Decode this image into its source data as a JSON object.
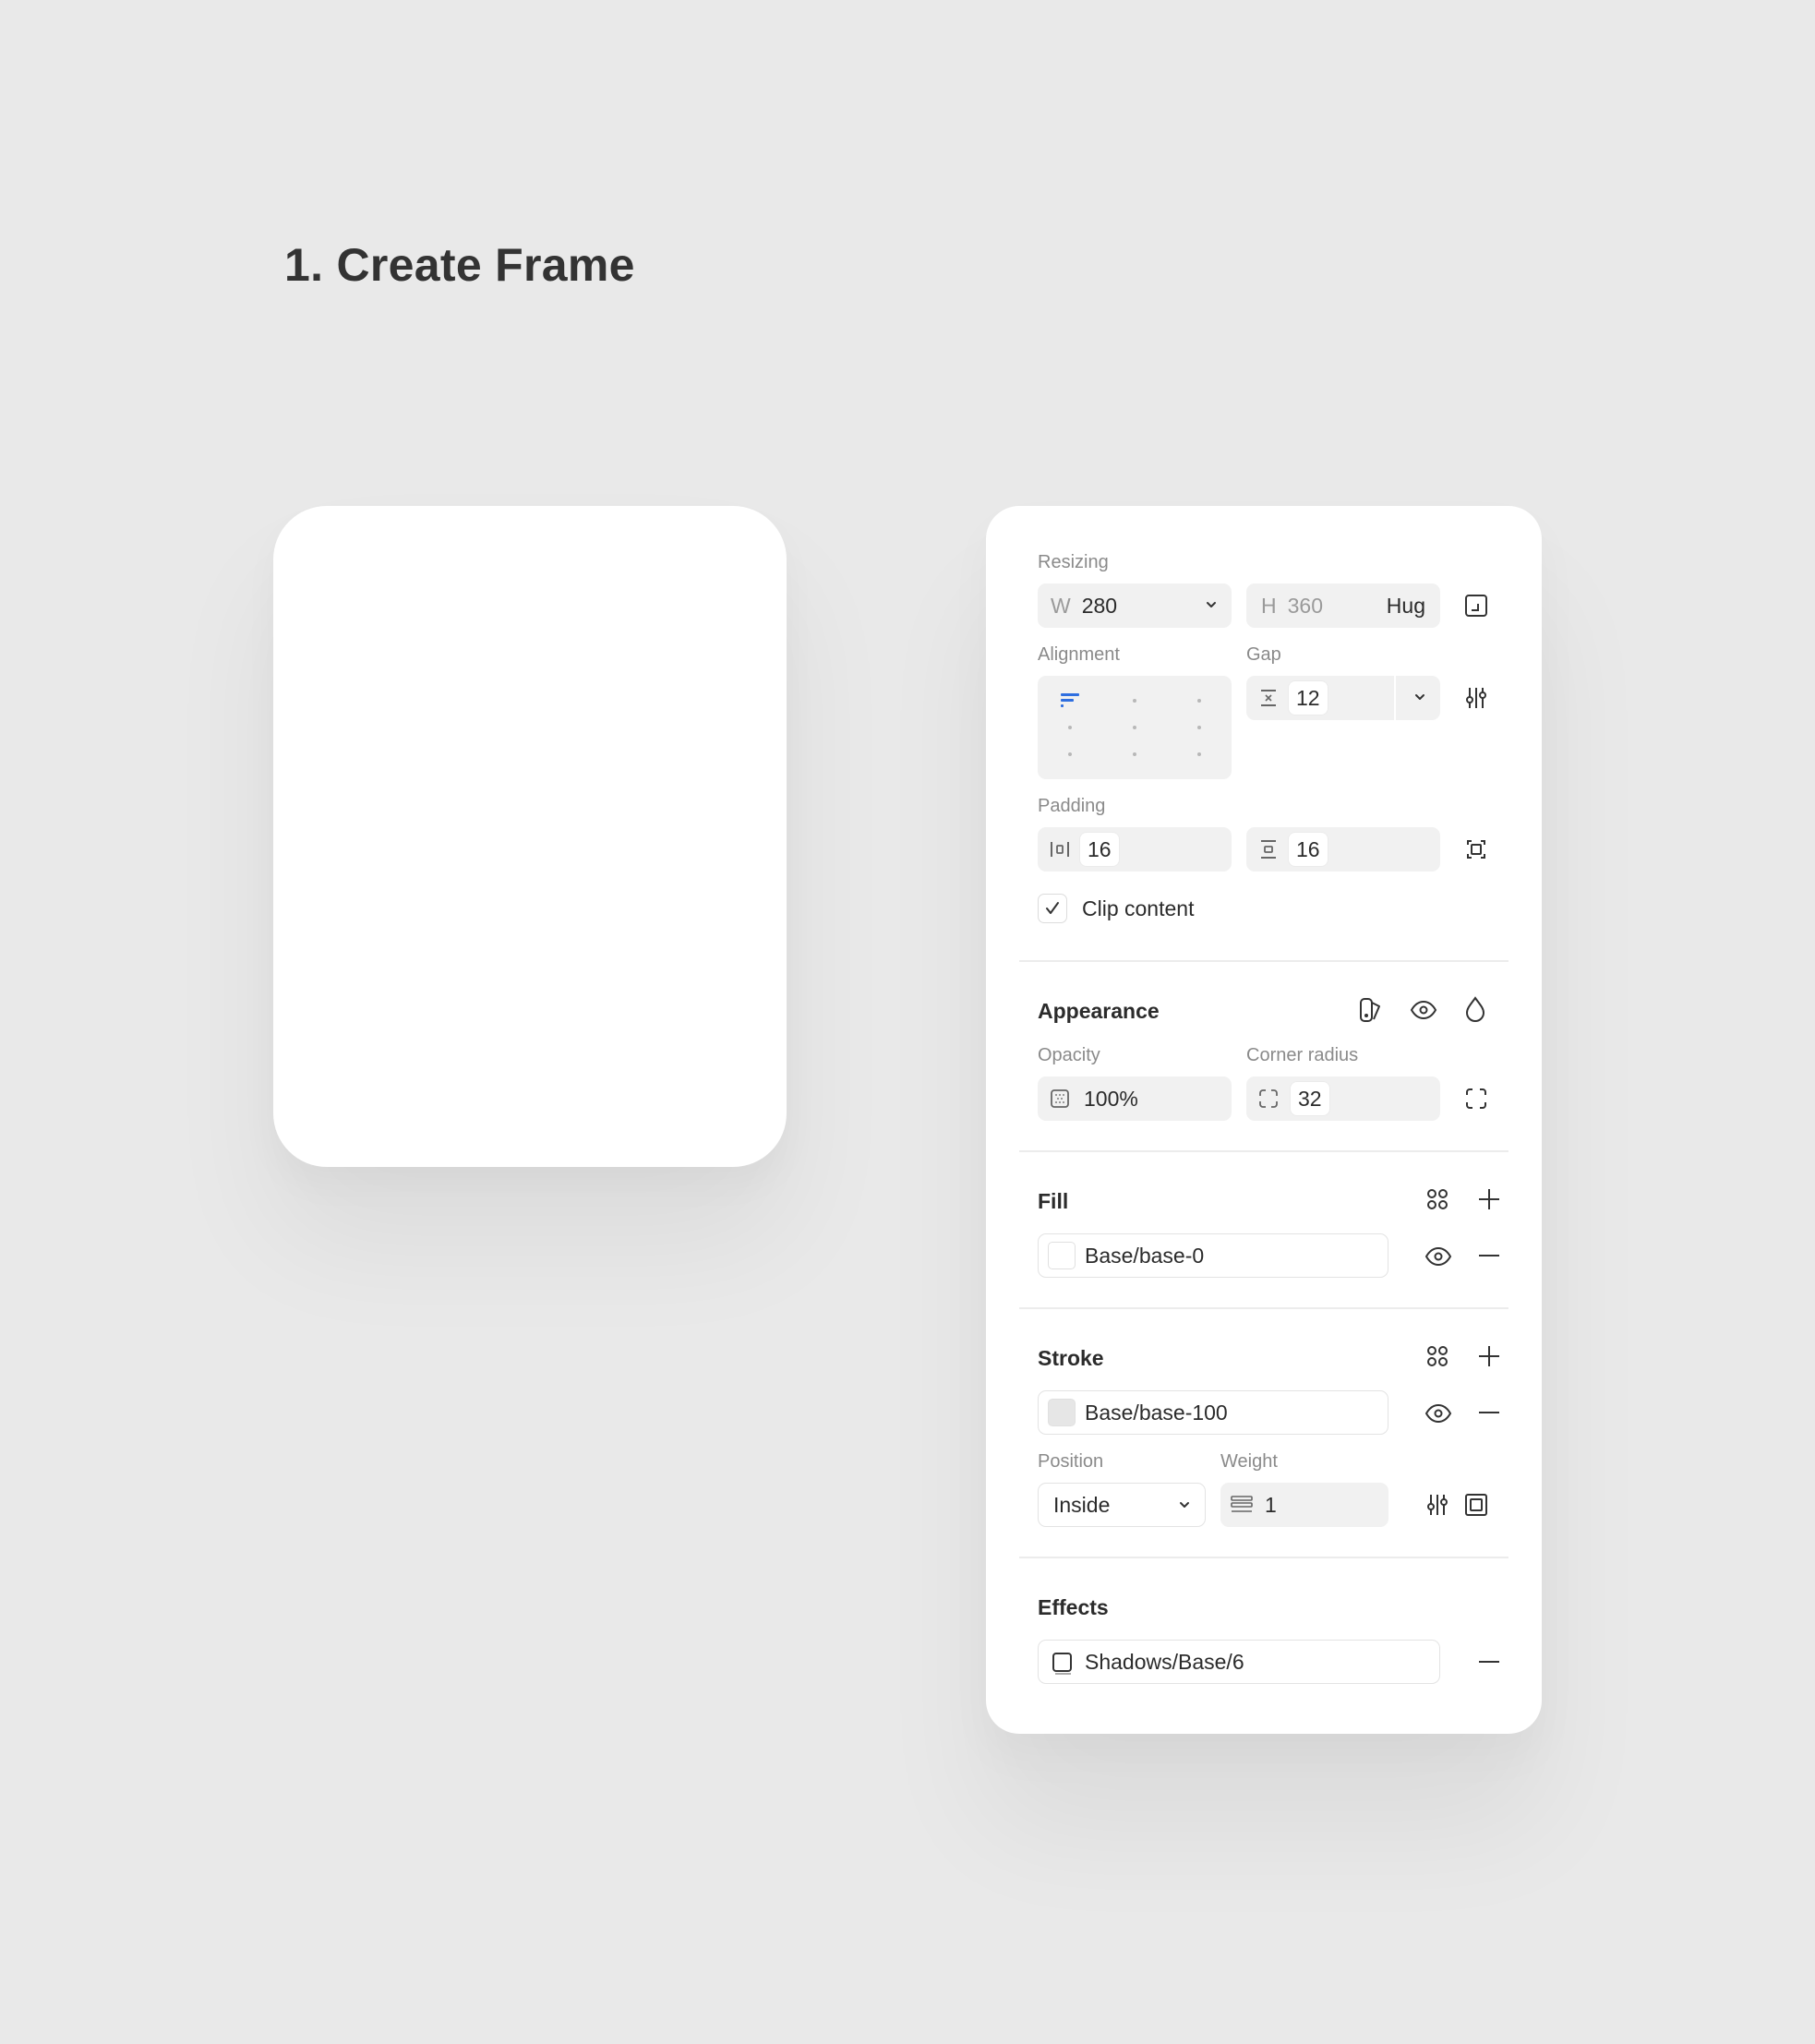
{
  "page": {
    "title": "1. Create Frame"
  },
  "resizing": {
    "label": "Resizing",
    "w_prefix": "W",
    "w_value": "280",
    "h_prefix": "H",
    "h_value": "360",
    "h_mode": "Hug"
  },
  "alignment": {
    "label": "Alignment",
    "selected": "top-left"
  },
  "gap": {
    "label": "Gap",
    "value": "12"
  },
  "padding": {
    "label": "Padding",
    "horizontal": "16",
    "vertical": "16"
  },
  "clip": {
    "label": "Clip content",
    "checked": true
  },
  "appearance": {
    "title": "Appearance",
    "opacity_label": "Opacity",
    "opacity_value": "100%",
    "radius_label": "Corner radius",
    "radius_value": "32"
  },
  "fill": {
    "title": "Fill",
    "value": "Base/base-0",
    "swatch": "#ffffff"
  },
  "stroke": {
    "title": "Stroke",
    "value": "Base/base-100",
    "swatch": "#e6e6e6",
    "position_label": "Position",
    "position_value": "Inside",
    "weight_label": "Weight",
    "weight_value": "1"
  },
  "effects": {
    "title": "Effects",
    "value": "Shadows/Base/6"
  },
  "colors": {
    "accent": "#2f6fe0",
    "background": "#e9e9e9",
    "panel": "#ffffff",
    "field": "#f1f1f1"
  }
}
